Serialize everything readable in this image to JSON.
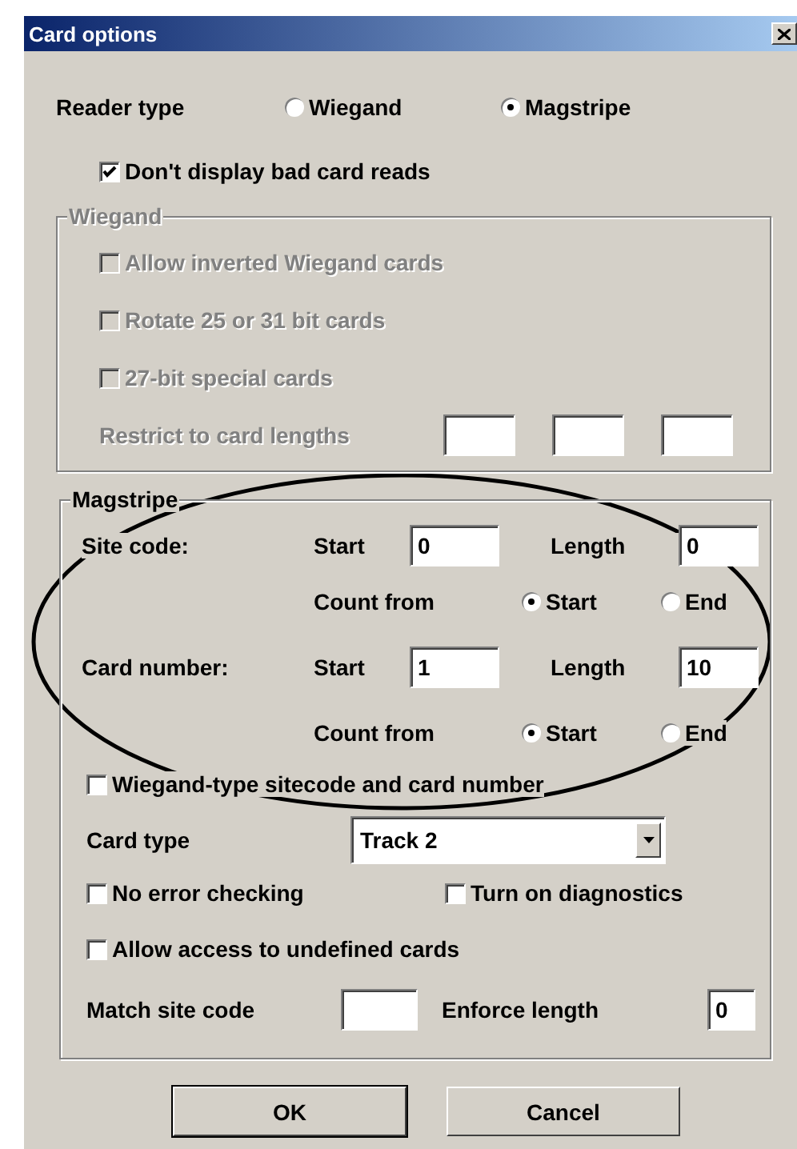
{
  "window": {
    "title": "Card options"
  },
  "reader_type": {
    "label": "Reader type",
    "options": [
      {
        "label": "Wiegand",
        "selected": false
      },
      {
        "label": "Magstripe",
        "selected": true
      }
    ]
  },
  "dont_display_bad_reads": {
    "label": "Don't display bad card reads",
    "checked": true
  },
  "wiegand": {
    "title": "Wiegand",
    "disabled": true,
    "options": [
      {
        "label": "Allow inverted Wiegand cards",
        "checked": false
      },
      {
        "label": "Rotate 25 or 31 bit cards",
        "checked": false
      },
      {
        "label": "27-bit special cards",
        "checked": false
      }
    ],
    "restrict_label": "Restrict to card lengths"
  },
  "magstripe": {
    "title": "Magstripe",
    "fields": [
      {
        "label": "Site code:",
        "start_label": "Start",
        "start": "0",
        "length_label": "Length",
        "length": "0",
        "count_from_label": "Count from",
        "count_from": [
          {
            "label": "Start",
            "selected": true
          },
          {
            "label": "End",
            "selected": false
          }
        ]
      },
      {
        "label": "Card number:",
        "start_label": "Start",
        "start": "1",
        "length_label": "Length",
        "length": "10",
        "count_from_label": "Count from",
        "count_from": [
          {
            "label": "Start",
            "selected": true
          },
          {
            "label": "End",
            "selected": false
          }
        ]
      }
    ],
    "wiegand_type": {
      "label": "Wiegand-type sitecode and card number",
      "checked": false
    },
    "card_type": {
      "label": "Card type",
      "value": "Track 2"
    },
    "options": [
      {
        "label": "No error checking",
        "checked": false
      },
      {
        "label": "Turn on diagnostics",
        "checked": false
      }
    ],
    "allow_undefined": {
      "label": "Allow access to undefined cards",
      "checked": false
    },
    "match_site_code": {
      "label": "Match site code"
    },
    "enforce_length": {
      "label": "Enforce length",
      "value": "0"
    }
  },
  "buttons": [
    {
      "label": "OK",
      "default": true
    },
    {
      "label": "Cancel",
      "default": false
    }
  ],
  "annotation": {
    "kind": "ellipse"
  }
}
